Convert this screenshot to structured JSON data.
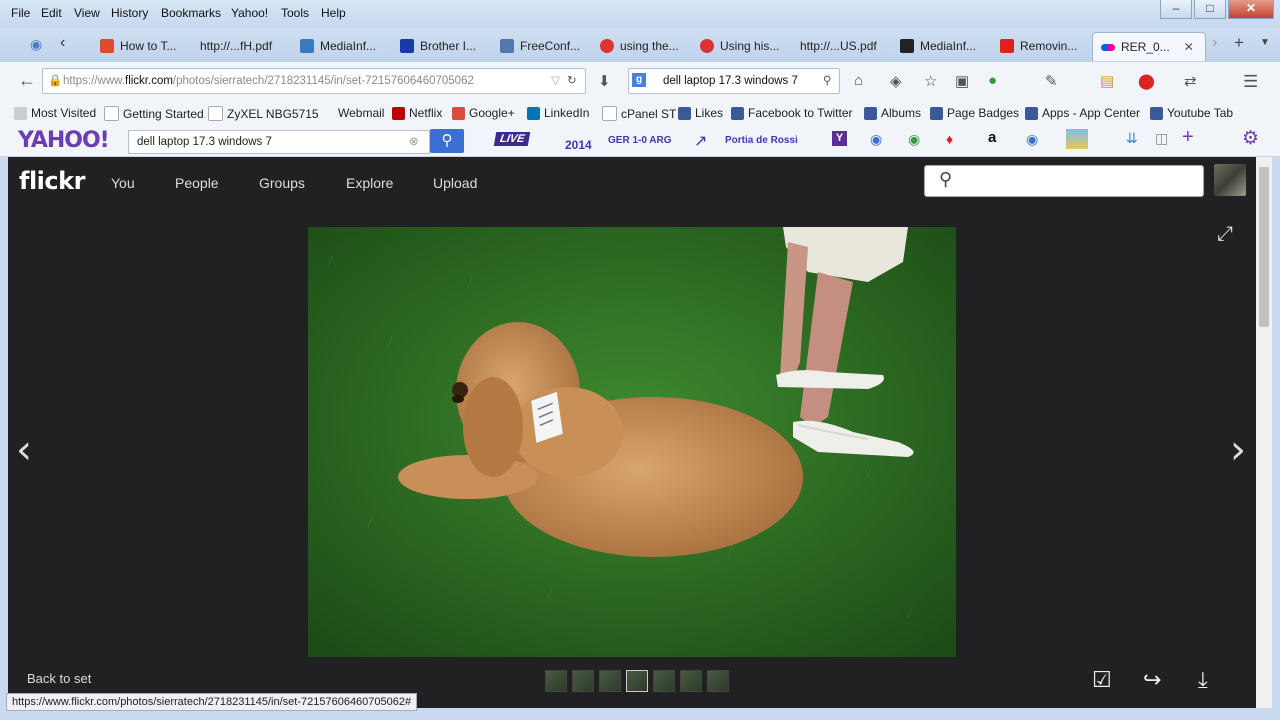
{
  "menubar": {
    "items": [
      "File",
      "Edit",
      "View",
      "History",
      "Bookmarks",
      "Yahoo!",
      "Tools",
      "Help"
    ],
    "window_controls": [
      "–",
      "□",
      "✕"
    ]
  },
  "tabs": [
    {
      "label": "How to T...",
      "favicon_color": "#e04a2f"
    },
    {
      "label": "http://...fH.pdf",
      "favicon_color": "#cccccc"
    },
    {
      "label": "MediaInf...",
      "favicon_color": "#3a7bbf"
    },
    {
      "label": "Brother I...",
      "favicon_color": "#1a3aa8"
    },
    {
      "label": "FreeConf...",
      "favicon_color": "#5577aa"
    },
    {
      "label": "using the...",
      "favicon_color": "#d33"
    },
    {
      "label": "Using his...",
      "favicon_color": "#d33"
    },
    {
      "label": "http://...US.pdf",
      "favicon_color": "#cccccc"
    },
    {
      "label": "MediaInf...",
      "favicon_color": "#222222"
    },
    {
      "label": "Removin...",
      "favicon_color": "#e02020"
    },
    {
      "label": "RER_0...",
      "favicon_color": "#e0177a",
      "active": true
    }
  ],
  "navbar": {
    "url_prefix": "https://www.",
    "url_domain": "flickr.com",
    "url_path": "/photos/sierratech/2718231145/in/set-72157606460705062",
    "search_value": "dell laptop 17.3 windows 7"
  },
  "bookmarks": [
    "Most Visited",
    "Getting Started",
    "ZyXEL NBG5715",
    "Webmail",
    "Netflix",
    "Google+",
    "LinkedIn",
    "cPanel ST",
    "Likes",
    "Facebook to Twitter",
    "Albums",
    "Page Badges",
    "Apps - App Center",
    "Youtube Tab"
  ],
  "yahoo_toolbar": {
    "logo": "YAHOO!",
    "search_value": "dell laptop 17.3 windows 7",
    "live": "LIVE",
    "worldcup": "2014",
    "score": "GER 1-0 ARG",
    "trending": "Portia de Rossi"
  },
  "flickr": {
    "logo": "flickr",
    "nav": [
      "You",
      "People",
      "Groups",
      "Explore",
      "Upload"
    ],
    "search_placeholder": "",
    "back_to_set": "Back to set",
    "thumbnail_count": 7,
    "selected_thumbnail": 4
  },
  "status_url": "https://www.flickr.com/photos/sierratech/2718231145/in/set-72157606460705062#"
}
